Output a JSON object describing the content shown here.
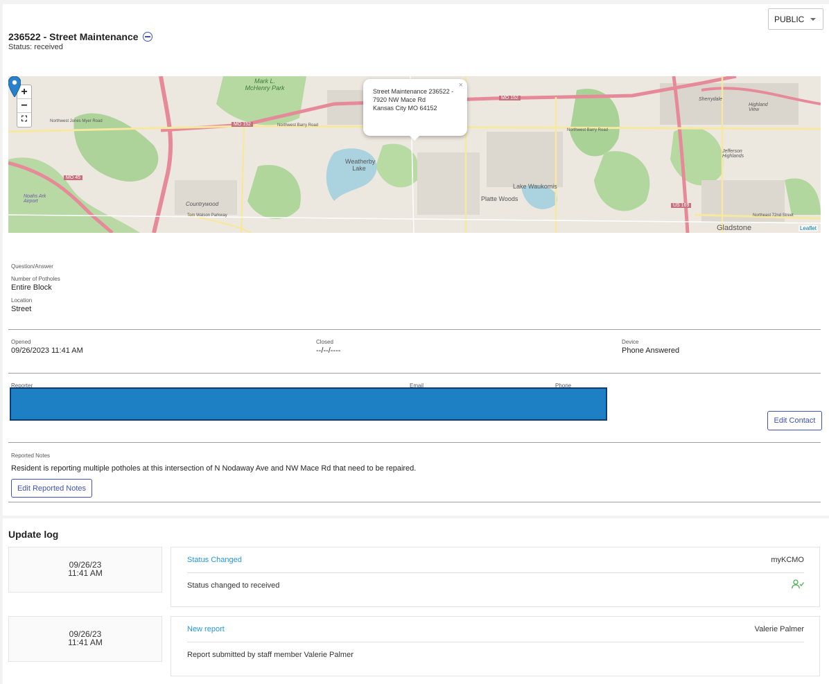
{
  "visibility": {
    "selected": "PUBLIC"
  },
  "request": {
    "title": "236522 - Street Maintenance",
    "status": "Status: received"
  },
  "map": {
    "popup_line1": "Street Maintenance 236522 -",
    "popup_line2": "7920 NW Mace Rd",
    "popup_line3": "Kansas City MO 64152",
    "attribution": "Leaflet",
    "zoom_in": "+",
    "zoom_out": "−",
    "fullscreen": "⛶",
    "labels": {
      "mchenry": "Mark L. McHenry Park",
      "weatherby": "Weatherby Lake",
      "platte_woods": "Platte Woods",
      "lake_waukomis": "Lake Waukomis",
      "gladstone": "Gladstone",
      "countrywood": "Countrywood",
      "jefferson": "Jefferson Highlands",
      "sherrydale": "Sherrydale",
      "highland_view": "Highland View",
      "airport": "Noahs Ark Airport"
    },
    "roads": {
      "mo152_a": "MO 152",
      "mo152_b": "MO 152",
      "mo45": "MO 45",
      "us169": "US 169",
      "nw_barry_a": "Northwest Barry Road",
      "nw_barry_b": "Northwest Barry Road",
      "nw_jones_myer": "Northwest Jones Myer Road",
      "nw_72nd": "Northeast 72nd Street",
      "tom_watson": "Tom Watson Parkway"
    }
  },
  "qa": {
    "heading": "Question/Answer",
    "q1_label": "Number of Potholes",
    "q1_value": "Entire Block",
    "q2_label": "Location",
    "q2_value": "Street"
  },
  "dates": {
    "opened_label": "Opened",
    "opened_value": "09/26/2023 11:41 AM",
    "closed_label": "Closed",
    "closed_value": "--/--/----",
    "device_label": "Device",
    "device_value": "Phone Answered"
  },
  "contact": {
    "reporter_label": "Reporter",
    "email_label": "Email",
    "phone_label": "Phone",
    "edit_contact": "Edit Contact"
  },
  "notes": {
    "label": "Reported Notes",
    "text": "Resident is reporting multiple potholes at this intersection of N Nodaway Ave and NW Mace Rd that need to be repaired.",
    "edit_button": "Edit Reported Notes"
  },
  "update_log": {
    "title": "Update log",
    "entries": [
      {
        "date": "09/26/23",
        "time": "11:41 AM",
        "title": "Status Changed",
        "author": "myKCMO",
        "description": "Status changed to received"
      },
      {
        "date": "09/26/23",
        "time": "11:41 AM",
        "title": "New report",
        "author": "Valerie Palmer",
        "description": "Report submitted by staff member Valerie Palmer"
      }
    ]
  },
  "colors": {
    "accent": "#3f51b5",
    "link": "#2196f3",
    "redaction": "#1d7fc4",
    "status_icon": "#4caf50"
  }
}
